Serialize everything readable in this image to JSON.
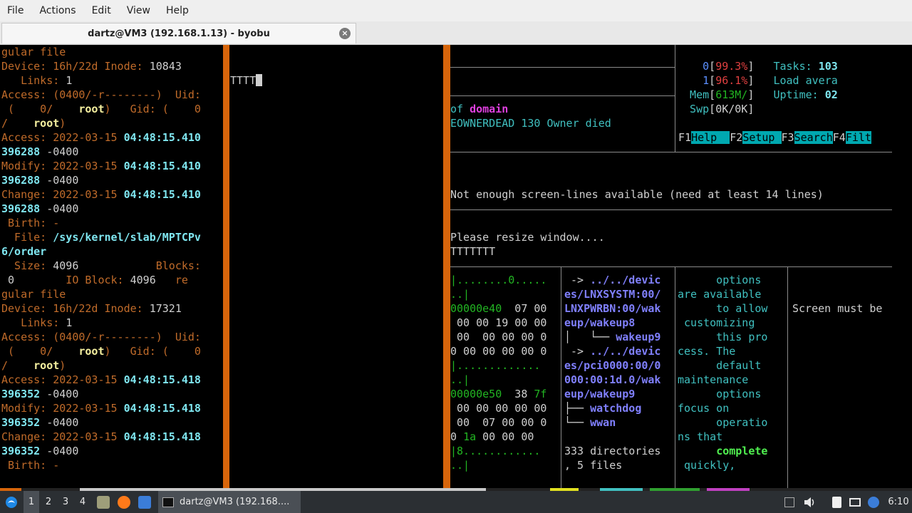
{
  "menubar": [
    "File",
    "Actions",
    "Edit",
    "View",
    "Help"
  ],
  "tab": {
    "title": "dartz@VM3 (192.168.1.13) - byobu",
    "close": "×"
  },
  "pane1": [
    [
      [
        "gular file",
        "c-or"
      ]
    ],
    [
      [
        "Device: 16h/22d Inode: ",
        "c-or"
      ],
      [
        "10843",
        "c-w"
      ]
    ],
    [
      [
        "   Links: ",
        "c-or"
      ],
      [
        "1",
        "c-w"
      ]
    ],
    [
      [
        "Access: (0400/-r--------)  Uid:",
        "c-or"
      ]
    ],
    [
      [
        " (    0/    ",
        "c-or"
      ],
      [
        "root",
        "c-y"
      ],
      [
        ")   Gid: (    0",
        "c-or"
      ]
    ],
    [
      [
        "/    ",
        "c-or"
      ],
      [
        "root",
        "c-y"
      ],
      [
        ")",
        "c-or"
      ]
    ],
    [
      [
        "Access: 2022-03-15 ",
        "c-or"
      ],
      [
        "04:48:15.410",
        "c-cy"
      ]
    ],
    [
      [
        "396288",
        "c-cy"
      ],
      [
        " -0400",
        "c-w"
      ]
    ],
    [
      [
        "Modify: 2022-03-15 ",
        "c-or"
      ],
      [
        "04:48:15.410",
        "c-cy"
      ]
    ],
    [
      [
        "396288",
        "c-cy"
      ],
      [
        " -0400",
        "c-w"
      ]
    ],
    [
      [
        "Change: 2022-03-15 ",
        "c-or"
      ],
      [
        "04:48:15.410",
        "c-cy"
      ]
    ],
    [
      [
        "396288",
        "c-cy"
      ],
      [
        " -0400",
        "c-w"
      ]
    ],
    [
      [
        " Birth: -",
        "c-or"
      ]
    ],
    [
      [
        "  File: ",
        "c-or"
      ],
      [
        "/sys/kernel/slab/MPTCPv",
        "c-cy"
      ]
    ],
    [
      [
        "6/order",
        "c-cy"
      ]
    ],
    [
      [
        "  Size: ",
        "c-or"
      ],
      [
        "4096",
        "c-w"
      ],
      [
        "            Blocks:",
        "c-or"
      ]
    ],
    [
      [
        " 0",
        "c-w"
      ],
      [
        "        IO Block: ",
        "c-or"
      ],
      [
        "4096",
        "c-w"
      ],
      [
        "   re",
        "c-or"
      ]
    ],
    [
      [
        "gular file",
        "c-or"
      ]
    ],
    [
      [
        "Device: 16h/22d Inode: ",
        "c-or"
      ],
      [
        "17321",
        "c-w"
      ]
    ],
    [
      [
        "   Links: ",
        "c-or"
      ],
      [
        "1",
        "c-w"
      ]
    ],
    [
      [
        "Access: (0400/-r--------)  Uid:",
        "c-or"
      ]
    ],
    [
      [
        " (    0/    ",
        "c-or"
      ],
      [
        "root",
        "c-y"
      ],
      [
        ")   Gid: (    0",
        "c-or"
      ]
    ],
    [
      [
        "/    ",
        "c-or"
      ],
      [
        "root",
        "c-y"
      ],
      [
        ")",
        "c-or"
      ]
    ],
    [
      [
        "Access: 2022-03-15 ",
        "c-or"
      ],
      [
        "04:48:15.418",
        "c-cy"
      ]
    ],
    [
      [
        "396352",
        "c-cy"
      ],
      [
        " -0400",
        "c-w"
      ]
    ],
    [
      [
        "Modify: 2022-03-15 ",
        "c-or"
      ],
      [
        "04:48:15.418",
        "c-cy"
      ]
    ],
    [
      [
        "396352",
        "c-cy"
      ],
      [
        " -0400",
        "c-w"
      ]
    ],
    [
      [
        "Change: 2022-03-15 ",
        "c-or"
      ],
      [
        "04:48:15.418",
        "c-cy"
      ]
    ],
    [
      [
        "396352",
        "c-cy"
      ],
      [
        " -0400",
        "c-w"
      ]
    ],
    [
      [
        " Birth: -",
        "c-or"
      ]
    ]
  ],
  "pane2": {
    "text": "TTTT"
  },
  "pane_domain": [
    [
      [
        "of ",
        "c-tl"
      ],
      [
        "domain",
        "c-mg"
      ]
    ],
    [
      [
        "EOWNERDEAD 130 Owner died",
        "c-tl"
      ]
    ]
  ],
  "htop": [
    [
      [
        "    0",
        "c-lb"
      ],
      [
        "[",
        "c-w"
      ],
      [
        "99.3%",
        "c-r"
      ],
      [
        "]",
        "c-w"
      ],
      [
        "   Tasks: ",
        "c-tl"
      ],
      [
        "103",
        "c-cy"
      ]
    ],
    [
      [
        "    1",
        "c-lb"
      ],
      [
        "[",
        "c-w"
      ],
      [
        "96.1%",
        "c-r"
      ],
      [
        "]",
        "c-w"
      ],
      [
        "   Load avera",
        "c-tl"
      ]
    ],
    [
      [
        "  Mem",
        "c-tl"
      ],
      [
        "[",
        "c-w"
      ],
      [
        "613M/",
        "c-g"
      ],
      [
        "]",
        "c-w"
      ],
      [
        "   Uptime: ",
        "c-tl"
      ],
      [
        "02",
        "c-cy"
      ]
    ],
    [
      [
        "  Swp",
        "c-tl"
      ],
      [
        "[",
        "c-w"
      ],
      [
        "0K/0K",
        "c-w"
      ],
      [
        "]",
        "c-w"
      ]
    ]
  ],
  "fkeys": [
    {
      "key": "F1",
      "label": "Help  "
    },
    {
      "key": "F2",
      "label": "Setup "
    },
    {
      "key": "F3",
      "label": "Search"
    },
    {
      "key": "F4",
      "label": "Filt"
    }
  ],
  "resize_msg": [
    "Not enough screen-lines available (need at least 14 lines)",
    "Please resize window...."
  ],
  "tline": "TTTTTTT",
  "hexdump": [
    [
      [
        "|........0.....",
        "c-g"
      ]
    ],
    [
      [
        "..|",
        "c-g"
      ]
    ],
    [
      [
        "00000e40",
        "c-g"
      ],
      [
        "  07 00",
        "c-w"
      ]
    ],
    [
      [
        " 00 00 19 00 00",
        "c-w"
      ]
    ],
    [
      [
        " 00  00 00 00 0",
        "c-w"
      ]
    ],
    [
      [
        "0 00 00 00 00 0",
        "c-w"
      ]
    ],
    [
      [
        "|.............",
        "c-g"
      ]
    ],
    [
      [
        "..|",
        "c-g"
      ]
    ],
    [
      [
        "00000e50",
        "c-g"
      ],
      [
        "  38 ",
        "c-w"
      ],
      [
        "7f",
        "c-g"
      ]
    ],
    [
      [
        " 00 00 00 00 00",
        "c-w"
      ]
    ],
    [
      [
        " 00  07 00 00 0",
        "c-w"
      ]
    ],
    [
      [
        "0 ",
        "c-w"
      ],
      [
        "1a",
        "c-g"
      ],
      [
        " 00 00 00",
        "c-w"
      ]
    ],
    [
      [
        "|8............",
        "c-g"
      ]
    ],
    [
      [
        "..|",
        "c-g"
      ]
    ]
  ],
  "tree": [
    [
      [
        " -> ",
        "c-w"
      ],
      [
        "../../devic",
        "c-blb"
      ]
    ],
    [
      [
        "es/LNXSYSTM:00/",
        "c-blb"
      ]
    ],
    [
      [
        "LNXPWRBN:00/wak",
        "c-blb"
      ]
    ],
    [
      [
        "eup/wakeup8",
        "c-blb"
      ]
    ],
    [
      [
        "│   └── ",
        "c-w"
      ],
      [
        "wakeup9",
        "c-blb"
      ]
    ],
    [
      [
        " -> ",
        "c-w"
      ],
      [
        "../../devic",
        "c-blb"
      ]
    ],
    [
      [
        "es/pci0000:00/0",
        "c-blb"
      ]
    ],
    [
      [
        "000:00:1d.0/wak",
        "c-blb"
      ]
    ],
    [
      [
        "eup/wakeup9",
        "c-blb"
      ]
    ],
    [
      [
        "├── ",
        "c-w"
      ],
      [
        "watchdog",
        "c-blb"
      ]
    ],
    [
      [
        "└── ",
        "c-w"
      ],
      [
        "wwan",
        "c-blb"
      ]
    ],
    [
      [
        "",
        "c-w"
      ]
    ],
    [
      [
        "333 directories",
        "c-w"
      ]
    ],
    [
      [
        ", 5 files",
        "c-w"
      ]
    ]
  ],
  "manpage": [
    [
      [
        "      options",
        "c-tl"
      ]
    ],
    [
      [
        "are available",
        "c-tl"
      ]
    ],
    [
      [
        "      to allow",
        "c-tl"
      ]
    ],
    [
      [
        " customizing",
        "c-tl"
      ]
    ],
    [
      [
        "      this pro",
        "c-tl"
      ]
    ],
    [
      [
        "cess. The",
        "c-tl"
      ]
    ],
    [
      [
        "      default",
        "c-tl"
      ]
    ],
    [
      [
        "maintenance",
        "c-tl"
      ]
    ],
    [
      [
        "      options",
        "c-tl"
      ]
    ],
    [
      [
        "focus on",
        "c-tl"
      ]
    ],
    [
      [
        "      operatio",
        "c-tl"
      ]
    ],
    [
      [
        "ns that",
        "c-tl"
      ]
    ],
    [
      [
        "      ",
        "c-tl"
      ],
      [
        "complete",
        "c-gb"
      ]
    ],
    [
      [
        " quickly,",
        "c-tl"
      ]
    ]
  ],
  "screen_msg": "Screen must be",
  "taskbar": {
    "workspaces": [
      "1",
      "2",
      "3",
      "4"
    ],
    "window": "dartz@VM3 (192.168....",
    "clock": "6:10"
  }
}
